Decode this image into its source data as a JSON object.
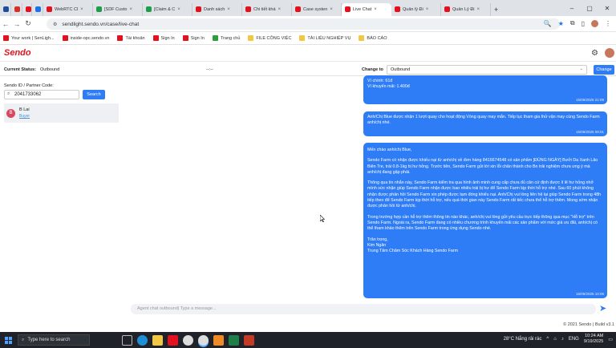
{
  "browser": {
    "tabs": [
      {
        "label": "(4)",
        "color": "#1f4e9c"
      },
      {
        "label": "M",
        "color": "#d93025"
      },
      {
        "label": "",
        "color": "#e5101d"
      },
      {
        "label": "",
        "color": "#1a73e8"
      },
      {
        "label": "WebRTC Cl",
        "color": "#e5101d"
      },
      {
        "label": "[SDF Custo",
        "color": "#1e9e4a"
      },
      {
        "label": "[Claim & C",
        "color": "#1e9e4a"
      },
      {
        "label": "Danh sách",
        "color": "#e5101d"
      },
      {
        "label": "Chi tiết khá",
        "color": "#e5101d"
      },
      {
        "label": "Case systen",
        "color": "#e5101d"
      },
      {
        "label": "Live Chat",
        "color": "#e5101d",
        "active": true
      },
      {
        "label": "Quản lý Đi",
        "color": "#e5101d"
      },
      {
        "label": "Quản Lý Đi",
        "color": "#e5101d"
      }
    ],
    "new_tab": "+",
    "url": "sendlight.sendo.vn/case/live-chat",
    "bookmarks": [
      {
        "label": "Your work | SenLigh...",
        "color": "#e5101d"
      },
      {
        "label": "inside-opc.sendo.vn",
        "color": "#e5101d"
      },
      {
        "label": "Tài khoản",
        "color": "#e5101d"
      },
      {
        "label": "Sign In",
        "color": "#e5101d"
      },
      {
        "label": "Sign In",
        "color": "#e5101d"
      },
      {
        "label": "Trang chủ",
        "color": "#2e9e3a"
      },
      {
        "label": "FILE CÔNG VIỆC",
        "color": "#f2c744"
      },
      {
        "label": "TÀI LIỆU NGHIỆP VỤ",
        "color": "#f2c744"
      },
      {
        "label": "BÁO CÁO",
        "color": "#f2c744"
      }
    ]
  },
  "app": {
    "logo": "Sendo",
    "current_status_label": "Current Status:",
    "current_status_value": "Outbound",
    "middle_text": "--:--",
    "change_to_label": "Change to",
    "change_to_value": "Outbound",
    "change_button": "Change",
    "partner_label": "Sendo ID / Partner Code:",
    "partner_value": "2041733062",
    "search_button": "Search",
    "conversation": {
      "initial": "B",
      "name": "B Lai",
      "status": "Buyer"
    },
    "composer_placeholder": "Agent chat outbound| Type a message...",
    "footer": "© 2021 Sendo | Build v3.1"
  },
  "messages": [
    {
      "lines": [
        "Ví chính: 61đ",
        "Ví khuyến mãi: 1.400đ"
      ],
      "time": "15/09/2025 21:09"
    },
    {
      "lines": [
        "Anh/Chị Blue  được nhận 1 lượt quay cho hoạt động Vòng quay may mắn. Tiếp tục tham gia thử vận may cùng Sendo Farm anh/chị nhé."
      ],
      "time": "15/09/2025 09:01"
    },
    {
      "paragraphs": [
        "Mến chào anh/chị Blue,",
        "Sendo Farm có nhận được khiếu nại từ anh/chị về đơn hàng 8416674548 có sản phẩm [ĐÚNG NGÀY] Bưởi Da Xanh Lão Biên Tre, trái 0.8-1kg bị hư hỏng. Trước tiên, Sendo Farm gửi lời xin lỗi chân thành cho Bn trải nghiệm chưa ưng ý mà anh/chị đang gặp phải.",
        "Thông qua tin nhắn này, Sendo Farm kiểm tra qua hình ảnh minh cung cấp chưa đủ căn cứ định được lí lẽ hư hỏng nhở mình sức nhận giúp Sendo Farm nhận được bao nhiêu trái bị hư để Sendo Farm kịp thời hỗ trợ nhé. Sau 60 phút không nhận được phản hồi Sendo Farm xin phép được tạm đóng khiếu nại. Anh/Chị vui lòng liên hệ lại giúp Sendo Farm trong 48h tiếp theo để Sendo Farm kịp thời hỗ trợ, nếu quá thời gian này Sendo Farm rất tiếc chưa thể hỗ trợ thêm. Mong sớm nhận được phản hồi từ anh/chị.",
        "Trong trường hợp cần hỗ trợ thêm thông tin nào khác, anh/chị vui lòng gửi yêu cầu trực tiếp thông qua mục \"Hỗ trợ\" trên Sendo Farm. Ngoài ra, Sendo Farm đang có nhiều chương trình khuyến mãi các sản phẩm với mức giá ưu đãi, anh/chị có thể tham khảo thêm trên Sendo Farm trong ứng dụng Sendo nhé.",
        "Trân trọng,\nKim Ngân\nTrung Tâm Chăm Sóc Khách Hàng Sendo Farm"
      ],
      "time": "16/09/2025 10:06"
    }
  ],
  "taskbar": {
    "search_placeholder": "Type here to search",
    "weather": "28°C  Nắng rải rác",
    "time": "10:24 AM",
    "date": "9/19/2025",
    "lang": "ENG"
  }
}
